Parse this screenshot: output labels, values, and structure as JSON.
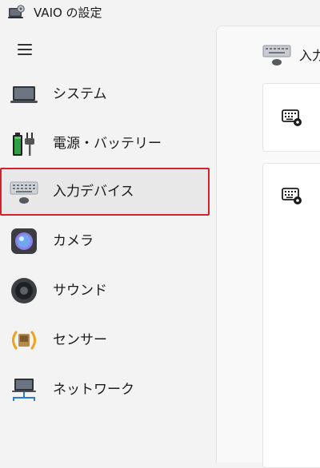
{
  "app": {
    "title": "VAIO の設定"
  },
  "nav": {
    "menu_icon": "hamburger-menu-icon",
    "items": [
      {
        "label": "システム",
        "icon": "laptop-icon"
      },
      {
        "label": "電源・バッテリー",
        "icon": "battery-plug-icon"
      },
      {
        "label": "入力デバイス",
        "icon": "keyboard-mouse-icon",
        "selected": true
      },
      {
        "label": "カメラ",
        "icon": "camera-lens-icon"
      },
      {
        "label": "サウンド",
        "icon": "speaker-icon"
      },
      {
        "label": "センサー",
        "icon": "sensor-icon"
      },
      {
        "label": "ネットワーク",
        "icon": "network-icon"
      }
    ]
  },
  "content": {
    "header_title": "入力",
    "cards": [
      {
        "icon": "keyboard-settings-icon"
      },
      {
        "icon": "keyboard-settings-icon"
      }
    ]
  },
  "colors": {
    "selection_outline": "#d6202e",
    "selected_background": "#e8e8e8",
    "window_background": "#f3f3f3"
  }
}
